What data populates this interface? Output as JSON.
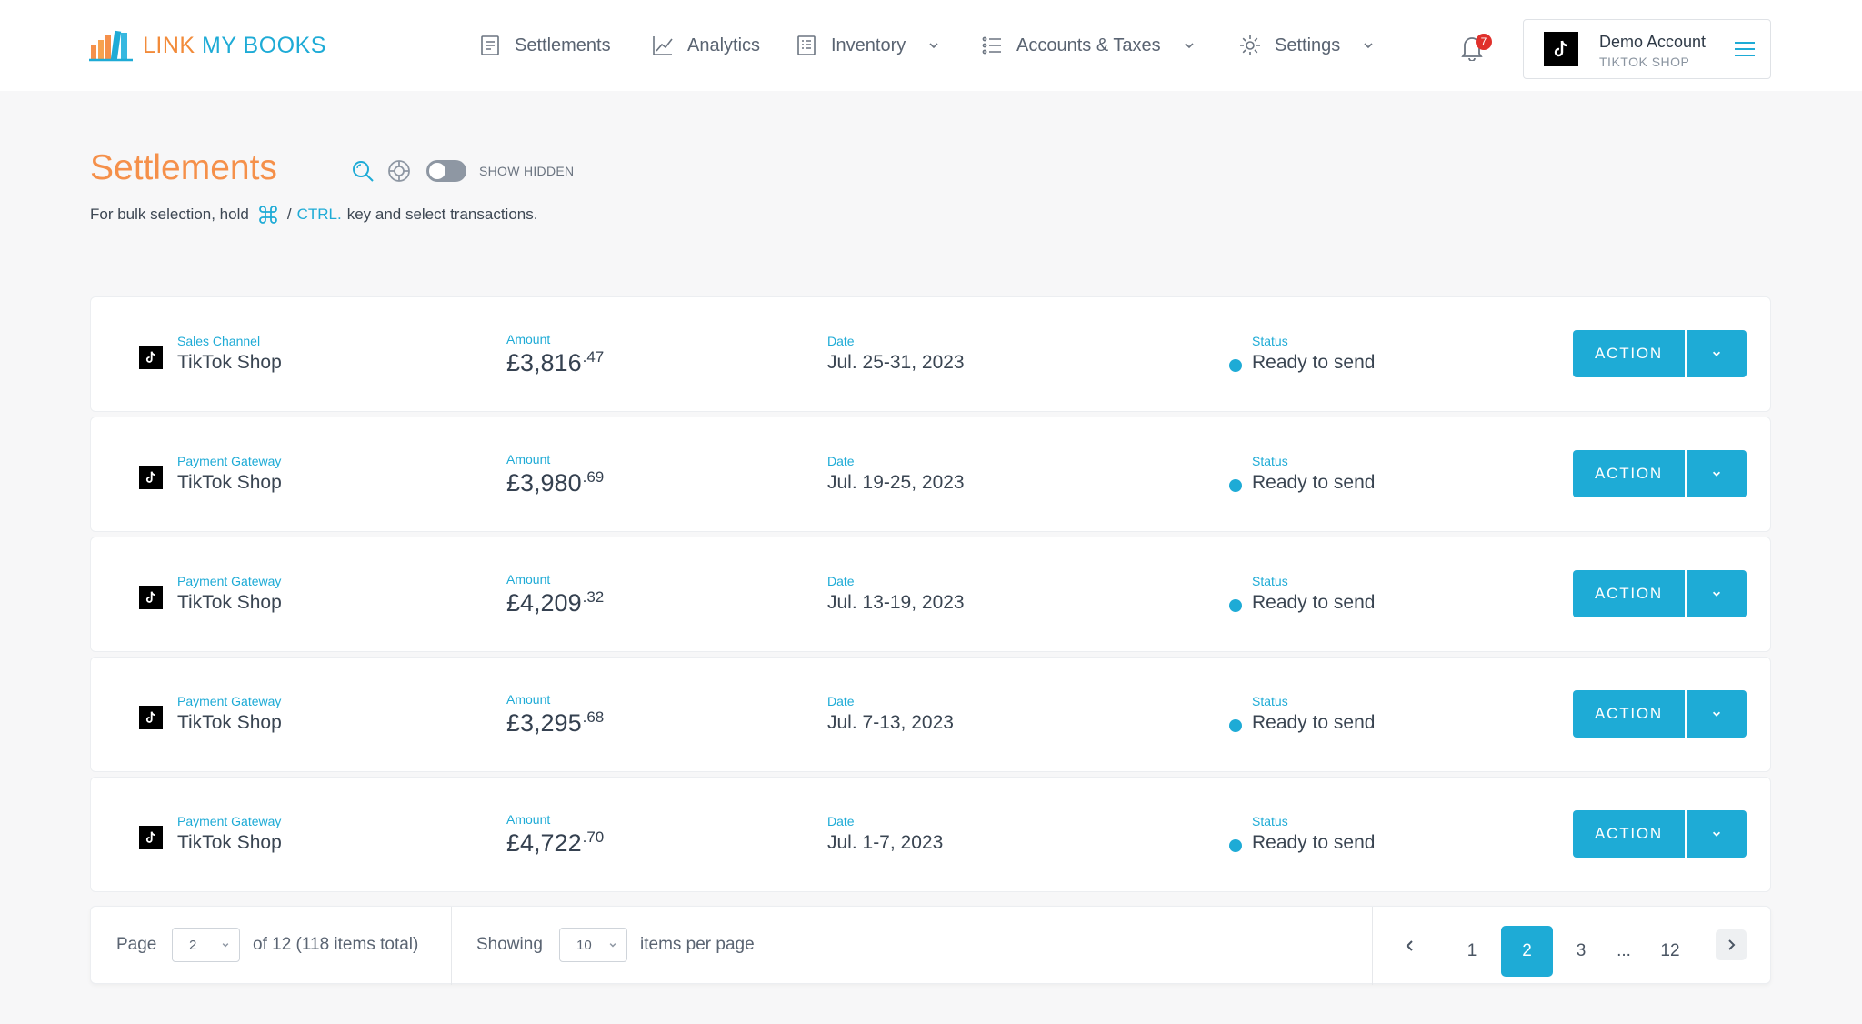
{
  "brand": {
    "prefix": "LINK",
    "rest": " MY BOOKS"
  },
  "nav": [
    {
      "label": "Settlements"
    },
    {
      "label": "Analytics"
    },
    {
      "label": "Inventory"
    },
    {
      "label": "Accounts & Taxes"
    },
    {
      "label": "Settings"
    }
  ],
  "notifications": {
    "count": "7"
  },
  "account": {
    "name": "Demo Account",
    "sub": "TIKTOK SHOP"
  },
  "page": {
    "title": "Settlements",
    "toggle_label": "SHOW HIDDEN",
    "hint_before": "For bulk selection, hold",
    "hint_sep": "/",
    "hint_ctrl": "CTRL.",
    "hint_after": "key and select transactions."
  },
  "labels": {
    "amount": "Amount",
    "date": "Date",
    "status": "Status",
    "action": "ACTION"
  },
  "settlements": [
    {
      "channel_type": "Sales Channel",
      "channel": "TikTok Shop",
      "amount_main": "£3,816",
      "amount_cents": ".47",
      "date": "Jul. 25-31, 2023",
      "status": "Ready to send"
    },
    {
      "channel_type": "Payment Gateway",
      "channel": "TikTok Shop",
      "amount_main": "£3,980",
      "amount_cents": ".69",
      "date": "Jul. 19-25, 2023",
      "status": "Ready to send"
    },
    {
      "channel_type": "Payment Gateway",
      "channel": "TikTok Shop",
      "amount_main": "£4,209",
      "amount_cents": ".32",
      "date": "Jul. 13-19, 2023",
      "status": "Ready to send"
    },
    {
      "channel_type": "Payment Gateway",
      "channel": "TikTok Shop",
      "amount_main": "£3,295",
      "amount_cents": ".68",
      "date": "Jul. 7-13, 2023",
      "status": "Ready to send"
    },
    {
      "channel_type": "Payment Gateway",
      "channel": "TikTok Shop",
      "amount_main": "£4,722",
      "amount_cents": ".70",
      "date": "Jul. 1-7, 2023",
      "status": "Ready to send"
    }
  ],
  "pagination": {
    "page_label": "Page",
    "current_page": "2",
    "of_text": "of 12 (118 items total)",
    "showing_label": "Showing",
    "per_page": "10",
    "per_page_suffix": "items per page",
    "pages": [
      "1",
      "2",
      "3",
      "...",
      "12"
    ]
  },
  "colors": {
    "accent": "#1eabd6",
    "brand_orange": "#f5904a",
    "badge": "#e0302b"
  }
}
